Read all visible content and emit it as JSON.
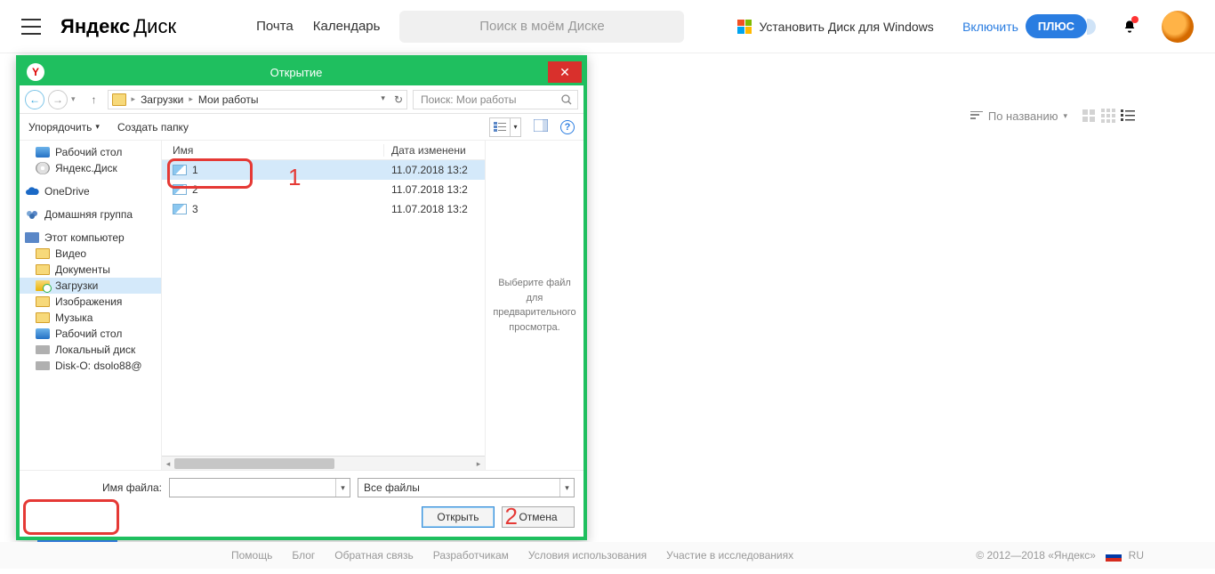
{
  "header": {
    "logo_bold": "Яндекс",
    "logo_rest": "Диск",
    "nav_mail": "Почта",
    "nav_calendar": "Календарь",
    "search_placeholder": "Поиск в моём Диске",
    "install_label": "Установить Диск для Windows",
    "enable_label": "Включить",
    "plus_label": "ПЛЮС"
  },
  "listbar": {
    "sort_label": "По названию"
  },
  "footer": {
    "help": "Помощь",
    "blog": "Блог",
    "feedback": "Обратная связь",
    "developers": "Разработчикам",
    "terms": "Условия использования",
    "research": "Участие в исследованиях",
    "copyright": "© 2012—2018 «Яндекс»",
    "lang": "RU"
  },
  "dialog": {
    "title": "Открытие",
    "breadcrumb": {
      "downloads": "Загрузки",
      "works": "Мои работы"
    },
    "search_placeholder": "Поиск: Мои работы",
    "organize": "Упорядочить",
    "new_folder": "Создать папку",
    "columns": {
      "name": "Имя",
      "date": "Дата изменени"
    },
    "files": [
      {
        "name": "1",
        "date": "11.07.2018 13:2"
      },
      {
        "name": "2",
        "date": "11.07.2018 13:2"
      },
      {
        "name": "3",
        "date": "11.07.2018 13:2"
      }
    ],
    "preview_text": "Выберите файл для предварительного просмотра.",
    "filename_label": "Имя файла:",
    "filter": "Все файлы",
    "open_btn": "Открыть",
    "cancel_btn": "Отмена",
    "tree": {
      "desktop": "Рабочий стол",
      "ydisk": "Яндекс.Диск",
      "onedrive": "OneDrive",
      "homegroup": "Домашняя группа",
      "thispc": "Этот компьютер",
      "videos": "Видео",
      "documents": "Документы",
      "downloads": "Загрузки",
      "pictures": "Изображения",
      "music": "Музыка",
      "desktop2": "Рабочий стол",
      "localdisk": "Локальный диск",
      "disko": "Disk-O: dsolo88@"
    }
  },
  "callouts": {
    "one": "1",
    "two": "2"
  }
}
